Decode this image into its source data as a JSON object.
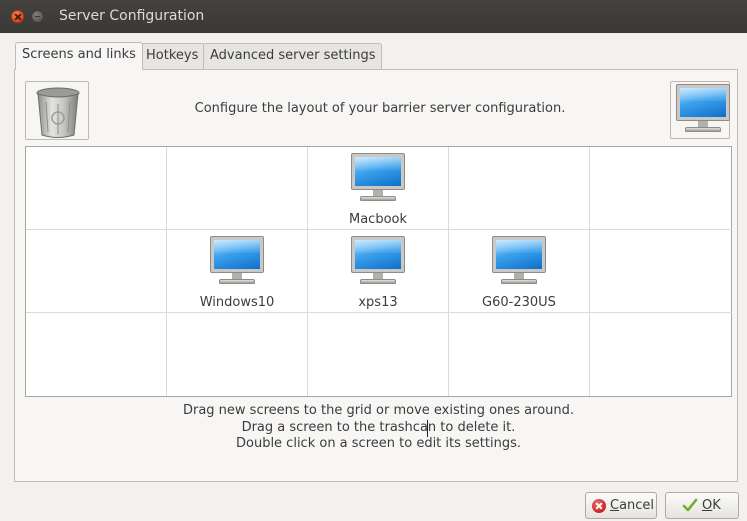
{
  "window": {
    "title": "Server Configuration"
  },
  "tabs": [
    {
      "label": "Screens and links",
      "active": true
    },
    {
      "label": "Hotkeys",
      "active": false
    },
    {
      "label": "Advanced server settings",
      "active": false
    }
  ],
  "main": {
    "description": "Configure the layout of your barrier server configuration.",
    "trash_icon": "trashcan-icon",
    "new_screen_icon": "monitor-icon"
  },
  "screens": [
    {
      "name": "Macbook",
      "row": 0,
      "col": 2
    },
    {
      "name": "Windows10",
      "row": 1,
      "col": 1
    },
    {
      "name": "xps13",
      "row": 1,
      "col": 2
    },
    {
      "name": "G60-230US",
      "row": 1,
      "col": 3
    }
  ],
  "hints": [
    "Drag new screens to the grid or move existing ones around.",
    "Drag a screen to the trashcan to delete it.",
    "Double click on a screen to edit its settings."
  ],
  "buttons": {
    "cancel": {
      "mnemonic": "C",
      "rest": "ancel"
    },
    "ok": {
      "mnemonic": "O",
      "rest": "K"
    }
  },
  "colors": {
    "accent": "#dd4814",
    "titlebar": "#3c3b37"
  }
}
